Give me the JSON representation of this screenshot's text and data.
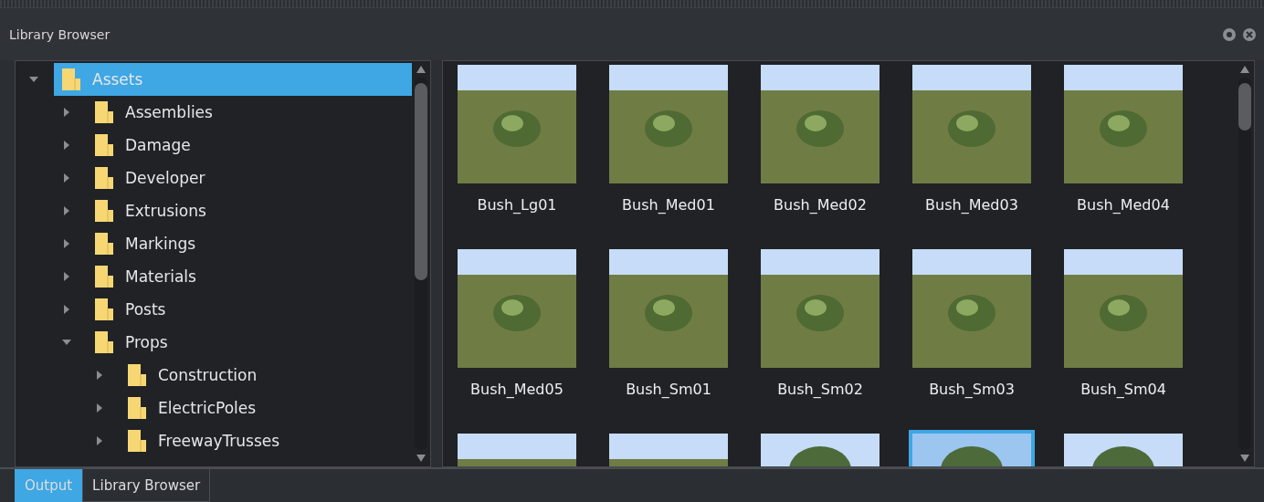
{
  "panel": {
    "title": "Library Browser"
  },
  "tree": [
    {
      "label": "Assets",
      "selected": true,
      "expanded": true,
      "children": [
        {
          "label": "Assemblies",
          "selected": false,
          "expanded": false
        },
        {
          "label": "Damage",
          "selected": false,
          "expanded": false
        },
        {
          "label": "Developer",
          "selected": false,
          "expanded": false
        },
        {
          "label": "Extrusions",
          "selected": false,
          "expanded": false
        },
        {
          "label": "Markings",
          "selected": false,
          "expanded": false
        },
        {
          "label": "Materials",
          "selected": false,
          "expanded": false
        },
        {
          "label": "Posts",
          "selected": false,
          "expanded": false
        },
        {
          "label": "Props",
          "selected": false,
          "expanded": true,
          "children": [
            {
              "label": "Construction",
              "selected": false,
              "expanded": false
            },
            {
              "label": "ElectricPoles",
              "selected": false,
              "expanded": false
            },
            {
              "label": "FreewayTrusses",
              "selected": false,
              "expanded": false
            }
          ]
        }
      ]
    }
  ],
  "assets": [
    {
      "label": "Bush_Lg01",
      "selected": false,
      "kind": "bush"
    },
    {
      "label": "Bush_Med01",
      "selected": false,
      "kind": "bush"
    },
    {
      "label": "Bush_Med02",
      "selected": false,
      "kind": "bush"
    },
    {
      "label": "Bush_Med03",
      "selected": false,
      "kind": "bush"
    },
    {
      "label": "Bush_Med04",
      "selected": false,
      "kind": "bush"
    },
    {
      "label": "Bush_Med05",
      "selected": false,
      "kind": "bush"
    },
    {
      "label": "Bush_Sm01",
      "selected": false,
      "kind": "bush"
    },
    {
      "label": "Bush_Sm02",
      "selected": false,
      "kind": "bush"
    },
    {
      "label": "Bush_Sm03",
      "selected": false,
      "kind": "bush"
    },
    {
      "label": "Bush_Sm04",
      "selected": false,
      "kind": "bush"
    },
    {
      "selected": false,
      "kind": "bush"
    },
    {
      "selected": false,
      "kind": "bush"
    },
    {
      "selected": false,
      "kind": "tree"
    },
    {
      "selected": true,
      "kind": "tree"
    },
    {
      "selected": false,
      "kind": "tree"
    }
  ],
  "bottom_tabs": [
    {
      "label": "Output",
      "selected": true
    },
    {
      "label": "Library Browser",
      "selected": false
    }
  ]
}
